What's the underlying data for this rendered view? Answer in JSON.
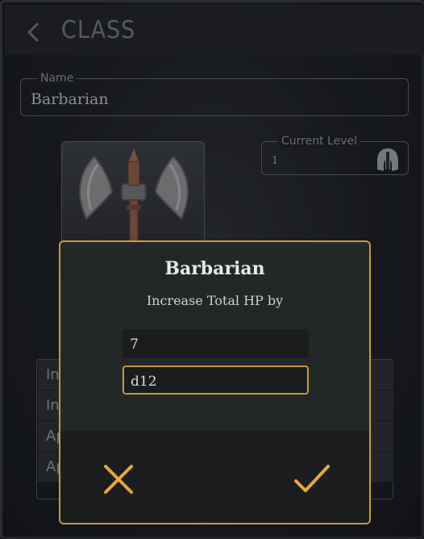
{
  "header": {
    "title": "CLASS",
    "back_icon": "chevron-left-icon"
  },
  "name_field": {
    "label": "Name",
    "value": "Barbarian"
  },
  "class_image": {
    "icon": "battle-axe-icon"
  },
  "level_field": {
    "label": "Current Level",
    "value": "1",
    "icon": "spartan-helmet-icon"
  },
  "list_rows": [
    {
      "label": "In"
    },
    {
      "label": "In"
    },
    {
      "label": "Ap"
    },
    {
      "label": "Ap"
    }
  ],
  "dialog": {
    "title": "Barbarian",
    "subtitle": "Increase Total HP by",
    "hp_amount": "7",
    "hit_die": "d12",
    "cancel_icon": "close-icon",
    "confirm_icon": "checkmark-icon"
  },
  "colors": {
    "accent": "#c99a3a",
    "background": "#1b1e24",
    "dialog": "#242728"
  }
}
